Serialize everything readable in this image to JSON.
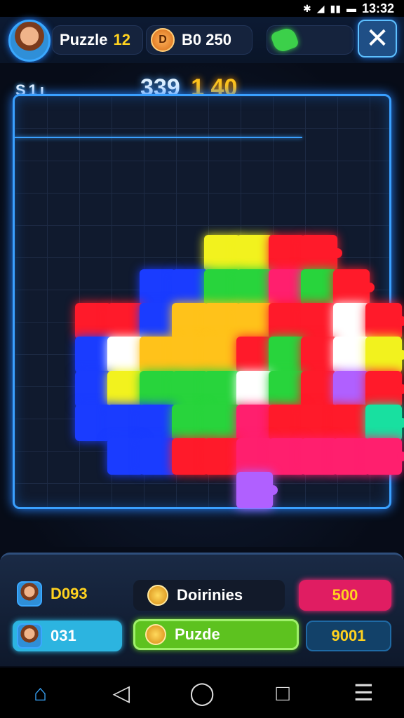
{
  "status_bar": {
    "time": "13:32",
    "icons": [
      "bluetooth-icon",
      "wifi-icon",
      "signal-icon",
      "battery-icon"
    ]
  },
  "header": {
    "level_label": "Puzzle",
    "level_value": "12",
    "coins": "B0 250",
    "coin_glyph": "D",
    "close_glyph": "✕"
  },
  "hud": {
    "left_label": "S1ı",
    "score_main": "339",
    "score_sub": "1 40"
  },
  "bottom_panel": {
    "player_score": "D093",
    "daily_label": "Doirinies",
    "pink_value": "500",
    "player_level": "031",
    "puzzle_label": "Puzde",
    "blue_value": "9001"
  },
  "nav": {
    "home": "⌂",
    "back": "◁",
    "circle": "◯",
    "square": "□",
    "menu": "☰"
  },
  "colors": {
    "accent": "#3aa0ff",
    "gold": "#ffd21f",
    "pink": "#e01d62",
    "green": "#5dc21f",
    "cyan": "#2cb4e0"
  }
}
